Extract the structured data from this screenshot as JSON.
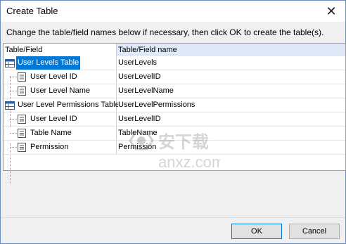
{
  "window": {
    "title": "Create Table"
  },
  "instruction": "Change the table/field names below if necessary, then click OK to create the table(s).",
  "columns": [
    "Table/Field",
    "Table/Field name"
  ],
  "rows": [
    {
      "field": "User Levels Table",
      "name": "UserLevels",
      "type": "table",
      "selected": true
    },
    {
      "field": "User Level ID",
      "name": "UserLevelID",
      "type": "field"
    },
    {
      "field": "User Level Name",
      "name": "UserLevelName",
      "type": "field"
    },
    {
      "field": "User Level Permissions Table",
      "name": "UserLevelPermissions",
      "type": "table"
    },
    {
      "field": "User Level ID",
      "name": "UserLevelID",
      "type": "field"
    },
    {
      "field": "Table Name",
      "name": "TableName",
      "type": "field"
    },
    {
      "field": "Permission",
      "name": "Permission",
      "type": "field"
    }
  ],
  "watermark": "anxz.com",
  "buttons": {
    "ok": "OK",
    "cancel": "Cancel"
  }
}
